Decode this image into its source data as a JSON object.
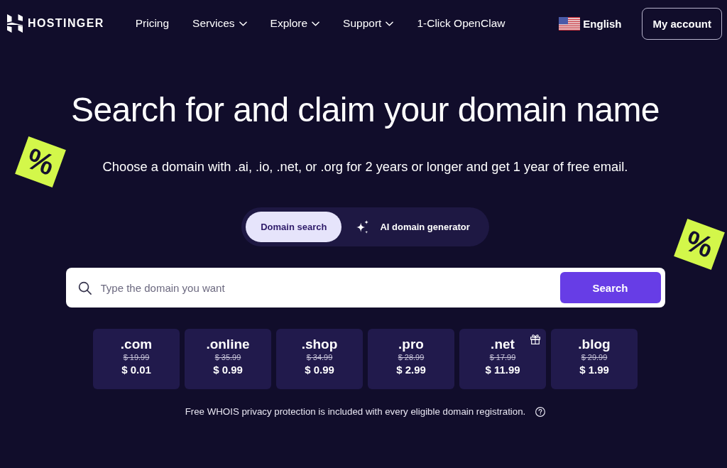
{
  "header": {
    "brand": "HOSTINGER",
    "nav": [
      {
        "label": "Pricing",
        "kind": "link"
      },
      {
        "label": "Services",
        "kind": "dropdown"
      },
      {
        "label": "Explore",
        "kind": "dropdown"
      },
      {
        "label": "Support",
        "kind": "dropdown"
      },
      {
        "label": "1-Click OpenClaw",
        "kind": "link"
      }
    ],
    "language": "English",
    "account_button": "My account"
  },
  "hero": {
    "title": "Search for and claim your domain name",
    "subtitle": "Choose a domain with .ai, .io, .net, or .org for 2 years or longer and get 1 year of free email."
  },
  "promo_tags": [
    {
      "symbol": "%"
    },
    {
      "symbol": "%"
    }
  ],
  "tabs": [
    {
      "label": "Domain search",
      "selected": true,
      "kind": "plain"
    },
    {
      "label": "AI domain generator",
      "selected": false,
      "kind": "icon"
    }
  ],
  "search": {
    "placeholder": "Type the domain you want",
    "button": "Search"
  },
  "domains": [
    {
      "extension": ".com",
      "old_price": "$ 19.99",
      "price": "$ 0.01",
      "bonus": false
    },
    {
      "extension": ".online",
      "old_price": "$ 35.99",
      "price": "$ 0.99",
      "bonus": false
    },
    {
      "extension": ".shop",
      "old_price": "$ 34.99",
      "price": "$ 0.99",
      "bonus": false
    },
    {
      "extension": ".pro",
      "old_price": "$ 28.99",
      "price": "$ 2.99",
      "bonus": false
    },
    {
      "extension": ".net",
      "old_price": "$ 17.99",
      "price": "$ 11.99",
      "bonus": true
    },
    {
      "extension": ".blog",
      "old_price": "$ 29.99",
      "price": "$ 1.99",
      "bonus": false
    }
  ],
  "note": "Free WHOIS privacy protection is included with every eligible domain registration."
}
